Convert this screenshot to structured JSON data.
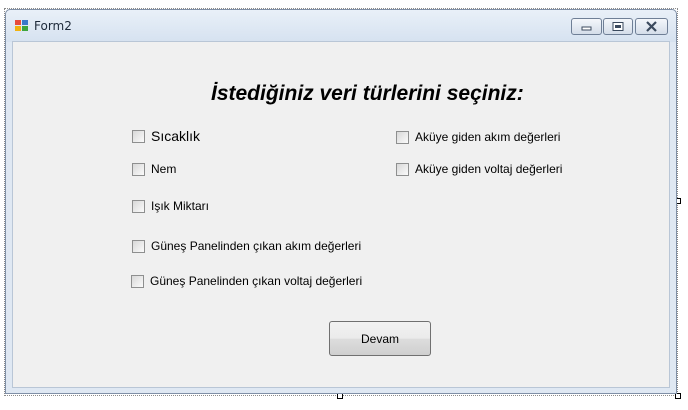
{
  "window": {
    "title": "Form2",
    "controls": [
      "minimize",
      "maximize",
      "close"
    ]
  },
  "form": {
    "heading": "İstediğiniz veri türlerini seçiniz:",
    "checkboxes": [
      {
        "label": "Sıcaklık",
        "checked": false
      },
      {
        "label": "Nem",
        "checked": false
      },
      {
        "label": "Işık Miktarı",
        "checked": false
      },
      {
        "label": "Güneş Panelinden çıkan akım değerleri",
        "checked": false
      },
      {
        "label": "Güneş Panelinden çıkan voltaj değerleri",
        "checked": false
      },
      {
        "label": "Aküye giden akım değerleri",
        "checked": false
      },
      {
        "label": "Aküye giden voltaj değerleri",
        "checked": false
      }
    ],
    "submit_label": "Devam"
  }
}
